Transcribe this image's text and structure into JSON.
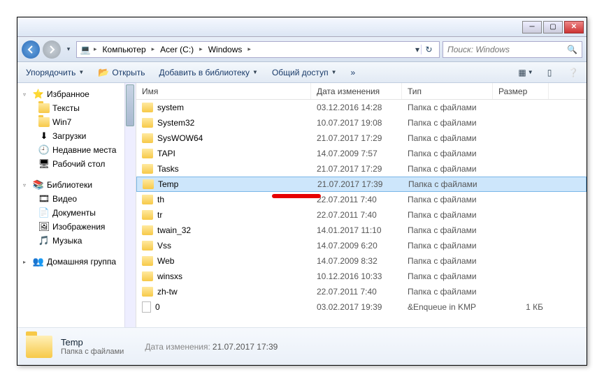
{
  "titlebar": {
    "min": "─",
    "max": "▢",
    "close": "✕"
  },
  "breadcrumb": {
    "items": [
      "Компьютер",
      "Acer (C:)",
      "Windows"
    ],
    "sep": "▸",
    "refresh": "↻"
  },
  "search": {
    "placeholder": "Поиск: Windows",
    "icon": "🔍"
  },
  "toolbar": {
    "organize": "Упорядочить",
    "open": "Открыть",
    "addlib": "Добавить в библиотеку",
    "share": "Общий доступ",
    "burn": "»"
  },
  "sidebar": {
    "fav": {
      "label": "Избранное",
      "exp": "▿"
    },
    "fav_items": [
      "Тексты",
      "Win7",
      "Загрузки",
      "Недавние места",
      "Рабочий стол"
    ],
    "lib": {
      "label": "Библиотеки",
      "exp": "▿"
    },
    "lib_items": [
      "Видео",
      "Документы",
      "Изображения",
      "Музыка"
    ],
    "home": {
      "label": "Домашняя группа",
      "exp": "▸"
    }
  },
  "columns": {
    "name": "Имя",
    "date": "Дата изменения",
    "type": "Тип",
    "size": "Размер"
  },
  "files": [
    {
      "name": "system",
      "date": "03.12.2016 14:28",
      "type": "Папка с файлами",
      "size": "",
      "kind": "folder"
    },
    {
      "name": "System32",
      "date": "10.07.2017 19:08",
      "type": "Папка с файлами",
      "size": "",
      "kind": "folder"
    },
    {
      "name": "SysWOW64",
      "date": "21.07.2017 17:29",
      "type": "Папка с файлами",
      "size": "",
      "kind": "folder"
    },
    {
      "name": "TAPI",
      "date": "14.07.2009 7:57",
      "type": "Папка с файлами",
      "size": "",
      "kind": "folder"
    },
    {
      "name": "Tasks",
      "date": "21.07.2017 17:29",
      "type": "Папка с файлами",
      "size": "",
      "kind": "folder"
    },
    {
      "name": "Temp",
      "date": "21.07.2017 17:39",
      "type": "Папка с файлами",
      "size": "",
      "kind": "folder",
      "selected": true
    },
    {
      "name": "th",
      "date": "22.07.2011 7:40",
      "type": "Папка с файлами",
      "size": "",
      "kind": "folder"
    },
    {
      "name": "tr",
      "date": "22.07.2011 7:40",
      "type": "Папка с файлами",
      "size": "",
      "kind": "folder"
    },
    {
      "name": "twain_32",
      "date": "14.01.2017 11:10",
      "type": "Папка с файлами",
      "size": "",
      "kind": "folder"
    },
    {
      "name": "Vss",
      "date": "14.07.2009 6:20",
      "type": "Папка с файлами",
      "size": "",
      "kind": "folder"
    },
    {
      "name": "Web",
      "date": "14.07.2009 8:32",
      "type": "Папка с файлами",
      "size": "",
      "kind": "folder"
    },
    {
      "name": "winsxs",
      "date": "10.12.2016 10:33",
      "type": "Папка с файлами",
      "size": "",
      "kind": "folder"
    },
    {
      "name": "zh-tw",
      "date": "22.07.2011 7:40",
      "type": "Папка с файлами",
      "size": "",
      "kind": "folder"
    },
    {
      "name": "0",
      "date": "03.02.2017 19:39",
      "type": "&Enqueue in KMP",
      "size": "1 КБ",
      "kind": "file"
    }
  ],
  "details": {
    "name": "Temp",
    "type": "Папка с файлами",
    "meta_label": "Дата изменения:",
    "meta_value": "21.07.2017 17:39"
  }
}
